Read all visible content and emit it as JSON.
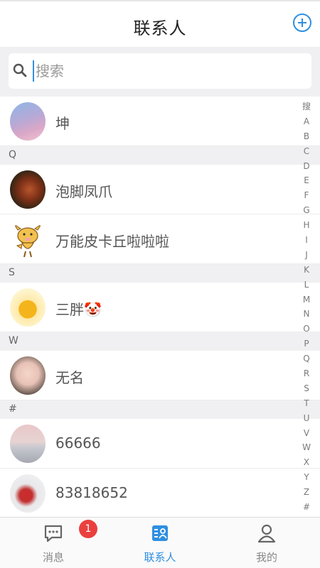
{
  "header": {
    "title": "联系人",
    "add_icon": "plus-circle-icon"
  },
  "search": {
    "placeholder": "搜索",
    "value": ""
  },
  "contacts": [
    {
      "name": "坤",
      "avatar": "sky-avatar"
    },
    {
      "section": "Q"
    },
    {
      "name": "泡脚凤爪",
      "avatar": "food-avatar"
    },
    {
      "name": "万能皮卡丘啦啦啦",
      "avatar": "cow-cartoon-avatar"
    },
    {
      "section": "S"
    },
    {
      "name": "三胖🤡",
      "avatar": "lemon-avatar"
    },
    {
      "section": "W"
    },
    {
      "name": "无名",
      "avatar": "boy-avatar"
    },
    {
      "section": "#"
    },
    {
      "name": "66666",
      "avatar": "sea-avatar"
    },
    {
      "name": "83818652",
      "avatar": "tree-avatar"
    }
  ],
  "index_letters": [
    "搜",
    "A",
    "B",
    "C",
    "D",
    "E",
    "F",
    "G",
    "H",
    "I",
    "J",
    "K",
    "L",
    "M",
    "N",
    "O",
    "P",
    "Q",
    "R",
    "S",
    "T",
    "U",
    "V",
    "W",
    "X",
    "Y",
    "Z",
    "#"
  ],
  "tabs": [
    {
      "label": "消息",
      "icon": "chat-bubble-icon",
      "badge": "1"
    },
    {
      "label": "联系人",
      "icon": "contacts-icon",
      "active": true
    },
    {
      "label": "我的",
      "icon": "person-icon"
    }
  ],
  "colors": {
    "accent": "#2f8fe0",
    "badge": "#e9403f"
  }
}
